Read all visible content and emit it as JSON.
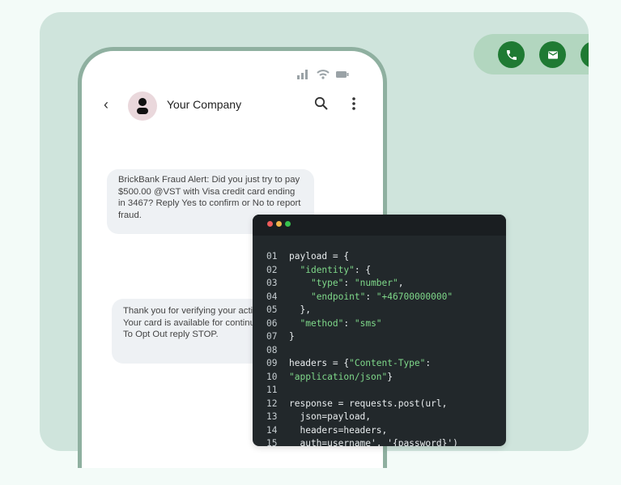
{
  "header": {
    "company_name": "Your Company"
  },
  "messages": [
    {
      "text": "BrickBank Fraud Alert: Did you just try to pay $500.00 @VST with Visa credit card ending in 3467? Reply Yes to confirm or No to report fraud."
    },
    {
      "text": "Thank you for verifying your activity. Your card is available for continued use. To Opt Out reply STOP."
    }
  ],
  "action_icons": [
    "phone-icon",
    "mail-icon",
    "bell-icon"
  ],
  "colors": {
    "accent_green": "#1f7a33",
    "code_string": "#7fd98a",
    "card_background": "#cfe4dc"
  },
  "code_lines": [
    {
      "n": "01",
      "parts": [
        {
          "t": "payload = {",
          "s": false
        }
      ]
    },
    {
      "n": "02",
      "parts": [
        {
          "t": "  ",
          "s": false
        },
        {
          "t": "\"identity\"",
          "s": true
        },
        {
          "t": ": {",
          "s": false
        }
      ]
    },
    {
      "n": "03",
      "parts": [
        {
          "t": "    ",
          "s": false
        },
        {
          "t": "\"type\"",
          "s": true
        },
        {
          "t": ": ",
          "s": false
        },
        {
          "t": "\"number\"",
          "s": true
        },
        {
          "t": ",",
          "s": false
        }
      ]
    },
    {
      "n": "04",
      "parts": [
        {
          "t": "    ",
          "s": false
        },
        {
          "t": "\"endpoint\"",
          "s": true
        },
        {
          "t": ": ",
          "s": false
        },
        {
          "t": "\"+46700000000\"",
          "s": true
        }
      ]
    },
    {
      "n": "05",
      "parts": [
        {
          "t": "  },",
          "s": false
        }
      ]
    },
    {
      "n": "06",
      "parts": [
        {
          "t": "  ",
          "s": false
        },
        {
          "t": "\"method\"",
          "s": true
        },
        {
          "t": ": ",
          "s": false
        },
        {
          "t": "\"sms\"",
          "s": true
        }
      ]
    },
    {
      "n": "07",
      "parts": [
        {
          "t": "}",
          "s": false
        }
      ]
    },
    {
      "n": "08",
      "parts": []
    },
    {
      "n": "09",
      "parts": [
        {
          "t": "headers = {",
          "s": false
        },
        {
          "t": "\"Content-Type\"",
          "s": true
        },
        {
          "t": ":",
          "s": false
        }
      ]
    },
    {
      "n": "10",
      "parts": [
        {
          "t": "\"application/json\"",
          "s": true
        },
        {
          "t": "}",
          "s": false
        }
      ]
    },
    {
      "n": "11",
      "parts": []
    },
    {
      "n": "12",
      "parts": [
        {
          "t": "response = requests.post(url,",
          "s": false
        }
      ]
    },
    {
      "n": "13",
      "parts": [
        {
          "t": "  json=payload,",
          "s": false
        }
      ]
    },
    {
      "n": "14",
      "parts": [
        {
          "t": "  headers=headers,",
          "s": false
        }
      ]
    },
    {
      "n": "15",
      "parts": [
        {
          "t": "  auth=username', '{password}')",
          "s": false
        }
      ]
    }
  ]
}
